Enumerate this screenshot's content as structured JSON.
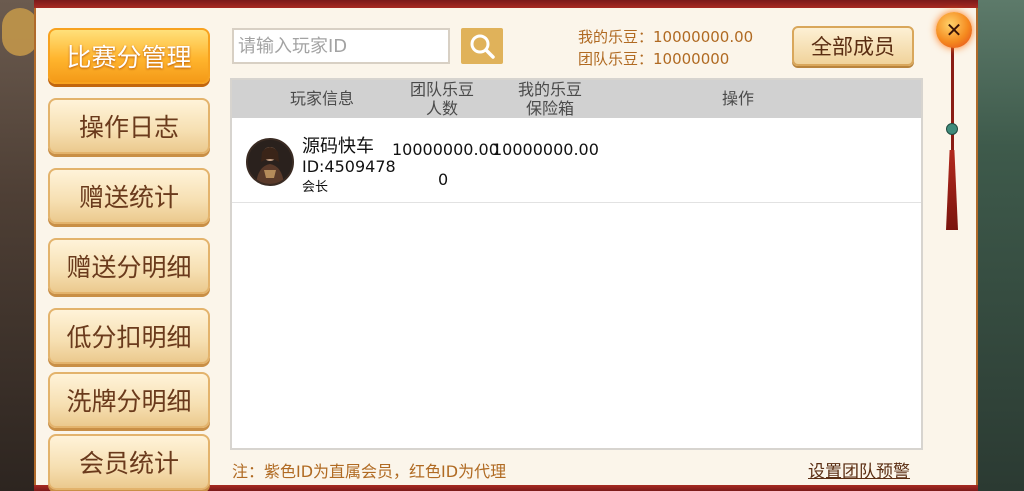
{
  "sidebar": {
    "items": [
      {
        "label": "比赛分管理",
        "active": true
      },
      {
        "label": "操作日志",
        "active": false
      },
      {
        "label": "赠送统计",
        "active": false
      },
      {
        "label": "赠送分明细",
        "active": false
      },
      {
        "label": "低分扣明细",
        "active": false
      },
      {
        "label": "洗牌分明细",
        "active": false
      },
      {
        "label": "会员统计",
        "active": false
      }
    ]
  },
  "search": {
    "placeholder": "请输入玩家ID",
    "icon": "search-icon"
  },
  "stats": {
    "my_beans": "我的乐豆：10000000.00",
    "team_beans": "团队乐豆：10000000"
  },
  "all_members_label": "全部成员",
  "table": {
    "headers": {
      "player_info": "玩家信息",
      "team_beans_1": "团队乐豆",
      "team_beans_2": "人数",
      "my_beans_1": "我的乐豆",
      "my_beans_2": "保险箱",
      "action": "操作"
    },
    "rows": [
      {
        "name": "源码快车",
        "id": "ID:4509478",
        "role": "会长",
        "team_beans_1": "10000000.00",
        "team_beans_2": "0",
        "safe_box": "10000000.00"
      }
    ]
  },
  "footer": {
    "note": "注：紫色ID为直属会员，红色ID为代理",
    "alert_link": "设置团队预警"
  },
  "close_icon": "close-icon",
  "colors": {
    "accent_orange": "#f49a18",
    "panel_bg": "#fbf5ea",
    "note_text": "#b06a22"
  }
}
